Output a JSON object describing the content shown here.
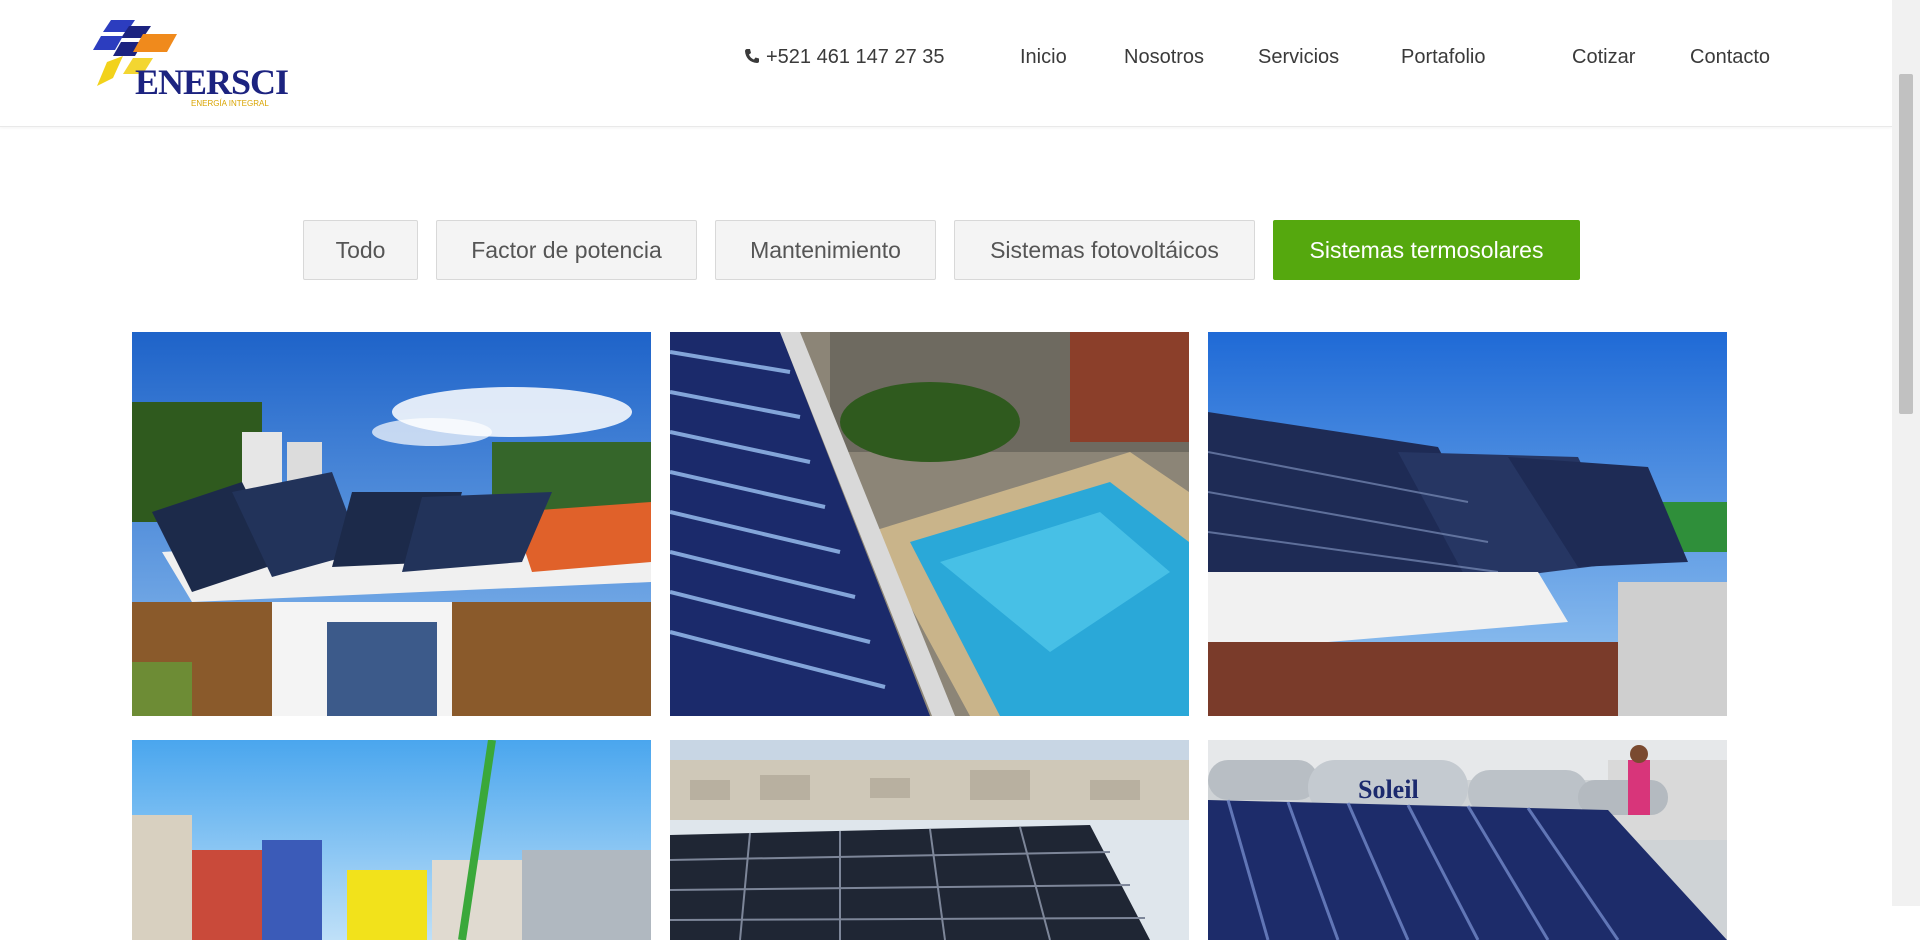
{
  "brand": {
    "name": "ENERSCI",
    "tagline": "ENERGÍA INTEGRAL",
    "colors": {
      "navy": "#1c2380",
      "orange": "#f08a1c",
      "yellow": "#f2d21b",
      "blue": "#2c3dbf"
    }
  },
  "nav": {
    "phone": "+521 461 147 27 35",
    "items": [
      "Inicio",
      "Nosotros",
      "Servicios",
      "Portafolio",
      "Cotizar",
      "Contacto"
    ]
  },
  "filters": {
    "items": [
      "Todo",
      "Factor de potencia",
      "Mantenimiento",
      "Sistemas fotovoltáicos",
      "Sistemas termosolares"
    ],
    "active": "Sistemas termosolares",
    "active_color": "#55a80e"
  },
  "gallery": {
    "tiles": [
      {
        "subject": "rooftop-solar-water-heaters-icon"
      },
      {
        "subject": "solar-tubes-pool-icon"
      },
      {
        "subject": "solar-collector-array-icon"
      },
      {
        "subject": "street-scene-icon"
      },
      {
        "subject": "photovoltaic-panels-icon"
      },
      {
        "subject": "soleil-water-heaters-icon",
        "brand_text": "Soleil"
      }
    ]
  }
}
